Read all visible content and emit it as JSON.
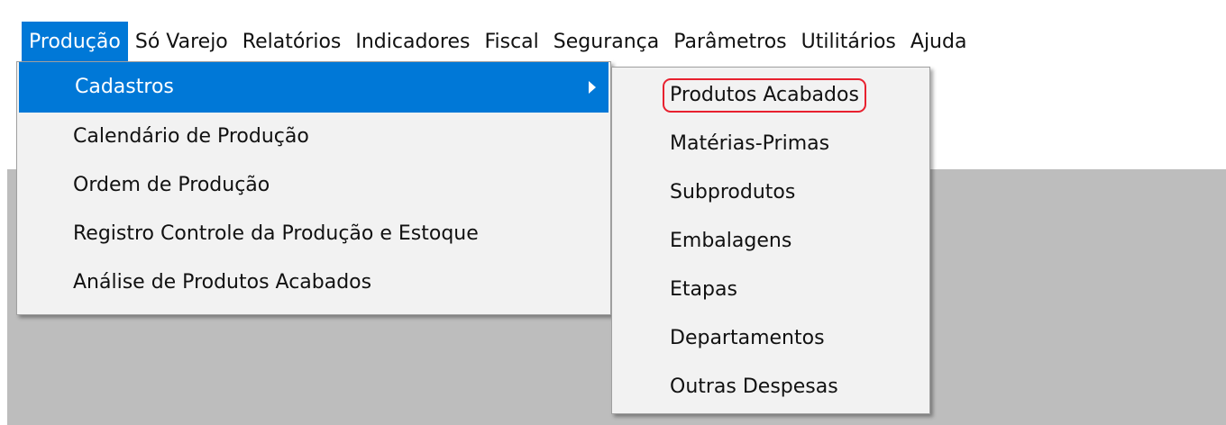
{
  "menubar": {
    "items": [
      "Produção",
      "Só Varejo",
      "Relatórios",
      "Indicadores",
      "Fiscal",
      "Segurança",
      "Parâmetros",
      "Utilitários",
      "Ajuda"
    ],
    "active": "Produção"
  },
  "producao_menu": {
    "items": [
      {
        "label": "Cadastros",
        "has_submenu": true
      },
      {
        "label": "Calendário de Produção"
      },
      {
        "label": "Ordem de Produção"
      },
      {
        "label": "Registro Controle da Produção e Estoque"
      },
      {
        "label": "Análise de Produtos Acabados"
      }
    ],
    "highlighted": "Cadastros"
  },
  "cadastros_submenu": {
    "items": [
      {
        "label": "Produtos Acabados",
        "annotation": "red-circle"
      },
      {
        "label": "Matérias-Primas"
      },
      {
        "label": "Subprodutos"
      },
      {
        "label": "Embalagens"
      },
      {
        "label": "Etapas"
      },
      {
        "label": "Departamentos"
      },
      {
        "label": "Outras Despesas"
      }
    ]
  },
  "colors": {
    "highlight": "#0078d7",
    "menu_background": "#f2f2f2",
    "workspace": "#bdbdbd",
    "annotation": "#e8212f"
  }
}
